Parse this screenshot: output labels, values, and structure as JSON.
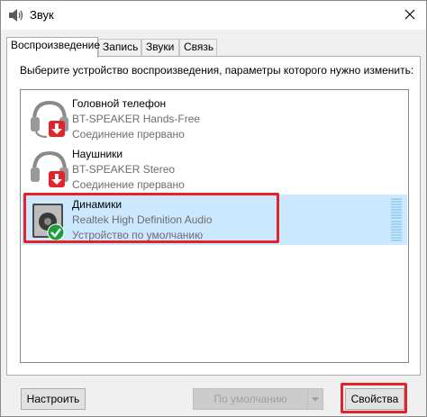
{
  "window": {
    "title": "Звук",
    "icons": {
      "app": "speaker-icon",
      "close": "close-icon"
    }
  },
  "tabs": [
    {
      "label": "Воспроизведение",
      "active": true
    },
    {
      "label": "Запись",
      "active": false
    },
    {
      "label": "Звуки",
      "active": false
    },
    {
      "label": "Связь",
      "active": false
    }
  ],
  "panel": {
    "instruction": "Выберите устройство воспроизведения, параметры которого нужно изменить:"
  },
  "devices": [
    {
      "name": "Головной телефон",
      "description": "BT-SPEAKER Hands-Free",
      "status": "Соединение прервано",
      "icon": "headset-icon",
      "badge": "disconnected-arrow-icon",
      "selected": false
    },
    {
      "name": "Наушники",
      "description": "BT-SPEAKER Stereo",
      "status": "Соединение прервано",
      "icon": "headphones-icon",
      "badge": "disconnected-arrow-icon",
      "selected": false
    },
    {
      "name": "Динамики",
      "description": "Realtek High Definition Audio",
      "status": "Устройство по умолчанию",
      "icon": "speaker-box-icon",
      "badge": "default-check-icon",
      "selected": true
    }
  ],
  "buttons": {
    "configure": "Настроить",
    "set_default": "По умолчанию",
    "properties": "Свойства"
  },
  "colors": {
    "selection": "#cce8ff",
    "highlight": "#e0242b",
    "disconnected": "#e0242b",
    "default_check": "#1e9e3e"
  }
}
